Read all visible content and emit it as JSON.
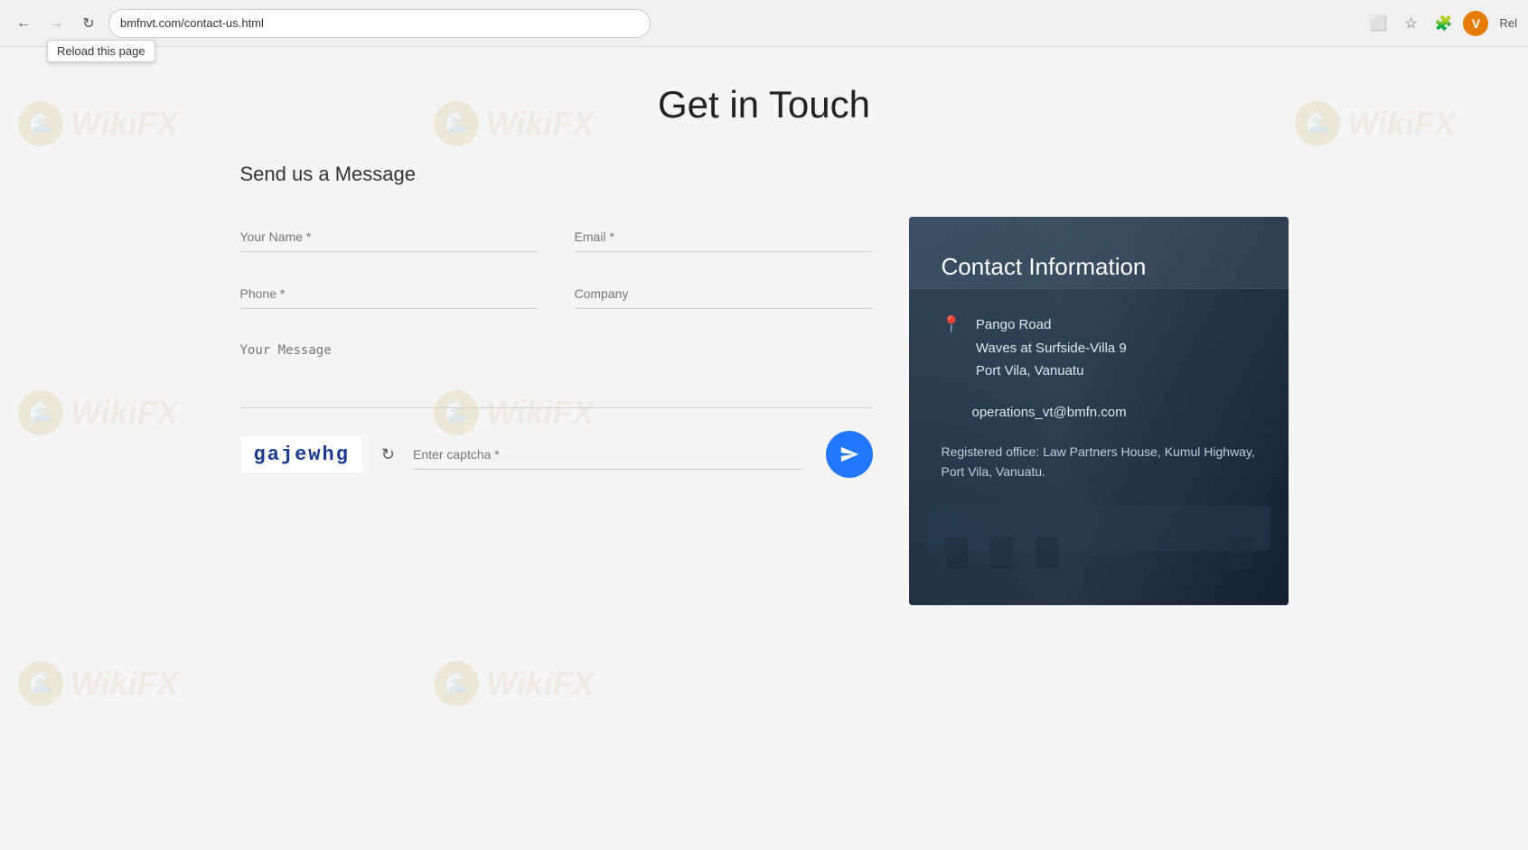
{
  "browser": {
    "url": "bmfnvt.com/contact-us.html",
    "reload_tooltip": "Reload this page",
    "profile_initial": "V",
    "rel_label": "Rel"
  },
  "page": {
    "title": "Get in Touch"
  },
  "form": {
    "section_title": "Send us a Message",
    "name_placeholder": "Your Name *",
    "email_placeholder": "Email *",
    "phone_placeholder": "Phone *",
    "company_placeholder": "Company",
    "message_placeholder": "Your Message",
    "captcha_text": "gajewhg",
    "captcha_placeholder": "Enter captcha *"
  },
  "contact_card": {
    "title": "Contact Information",
    "address_line1": "Pango Road",
    "address_line2": "Waves at Surfside-Villa 9",
    "address_line3": "Port Vila, Vanuatu",
    "email": "operations_vt@bmfn.com",
    "registered_office": "Registered office: Law Partners House, Kumul Highway, Port Vila, Vanuatu."
  }
}
